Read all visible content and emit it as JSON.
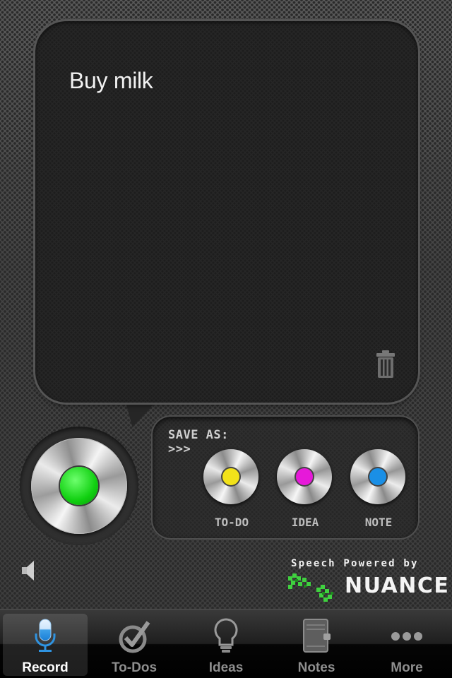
{
  "bubble": {
    "text": "Buy milk",
    "trash_icon": "trash-icon"
  },
  "record": {
    "dot_color": "#11d011"
  },
  "save_as": {
    "label": "SAVE AS:",
    "arrows": ">>>",
    "options": [
      {
        "label": "TO-DO",
        "color": "#f2e21a"
      },
      {
        "label": "IDEA",
        "color": "#e619d9"
      },
      {
        "label": "NOTE",
        "color": "#1a8fe6"
      }
    ]
  },
  "speaker_icon": "speaker-icon",
  "branding": {
    "powered_by": "Speech Powered by",
    "name": "NUANCE"
  },
  "tabs": [
    {
      "label": "Record",
      "icon": "microphone-icon",
      "active": true
    },
    {
      "label": "To-Dos",
      "icon": "checkmark-icon",
      "active": false
    },
    {
      "label": "Ideas",
      "icon": "lightbulb-icon",
      "active": false
    },
    {
      "label": "Notes",
      "icon": "notebook-icon",
      "active": false
    },
    {
      "label": "More",
      "icon": "more-icon",
      "active": false
    }
  ]
}
